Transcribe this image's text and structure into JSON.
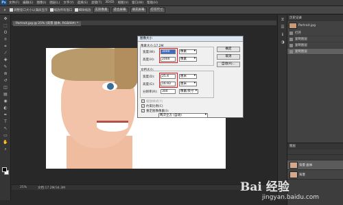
{
  "app": {
    "logo": "Ps"
  },
  "menubar": {
    "items": [
      "文件(F)",
      "编辑(E)",
      "图像(I)",
      "图层(L)",
      "文字(Y)",
      "选择(S)",
      "滤镜(T)",
      "3D(D)",
      "视图(V)",
      "窗口(W)",
      "帮助(H)"
    ]
  },
  "options": {
    "zoom_checkbox": "调整窗口大小以满屏显示",
    "all_windows": "缩放所有窗口",
    "scrubby": "细微缩放",
    "actual_pixels": "实际像素",
    "fit_screen": "适合屏幕",
    "fill_screen": "填充屏幕",
    "print_size": "打印尺寸"
  },
  "toolbar": {
    "icons": [
      "move-icon",
      "marquee-icon",
      "lasso-icon",
      "quick-select-icon",
      "crop-icon",
      "eyedropper-icon",
      "heal-icon",
      "brush-icon",
      "stamp-icon",
      "history-brush-icon",
      "eraser-icon",
      "gradient-icon",
      "blur-icon",
      "dodge-icon",
      "pen-icon",
      "type-icon",
      "path-select-icon",
      "shape-icon",
      "hand-icon",
      "zoom-icon"
    ],
    "glyphs": [
      "✥",
      "⬚",
      "ʘ",
      "⌾",
      "⌗",
      "⁄",
      "✚",
      "✎",
      "⊛",
      "↺",
      "◫",
      "▤",
      "◉",
      "◐",
      "✒",
      "T",
      "↖",
      "▭",
      "✋",
      "⌕"
    ]
  },
  "document": {
    "tab": "Portrait.jpg @ 25% (背景 副本, RGB/8#) *",
    "zoom": "25%",
    "doc_info": "文档:17.2M/34.3M"
  },
  "dialog": {
    "title": "图像大小",
    "pixel_dims": "像素大小:17.2M",
    "width_label": "宽度(W):",
    "width_value": "3000",
    "width_unit": "像素",
    "height_label": "高度(H):",
    "height_value": "2000",
    "height_unit": "像素",
    "doc_size": "文档大小:",
    "doc_width_label": "宽度(D):",
    "doc_width_value": "25.4",
    "doc_width_unit": "厘米",
    "doc_height_label": "高度(G):",
    "doc_height_value": "16.93",
    "doc_height_unit": "厘米",
    "resolution_label": "分辨率(R):",
    "resolution_value": "300",
    "resolution_unit": "像素/英寸",
    "scale_styles": "缩放样式(Y)",
    "constrain": "约束比例(C)",
    "resample": "重定图像像素(I):",
    "resample_method": "两次立方 (自动)",
    "ok": "确定",
    "cancel": "取消",
    "auto": "自动(A)..."
  },
  "panel": {
    "history_tab": "历史记录",
    "history_thumb_label": "Portrait.jpg",
    "history_items": [
      "打开",
      "复制图层",
      "复制图层",
      "复制图层"
    ],
    "layers_tab": "图层",
    "layer_names": [
      "背景 副本",
      "背景"
    ]
  },
  "watermark": {
    "brand": "Bai 经验",
    "url": "jingyan.baidu.com"
  }
}
